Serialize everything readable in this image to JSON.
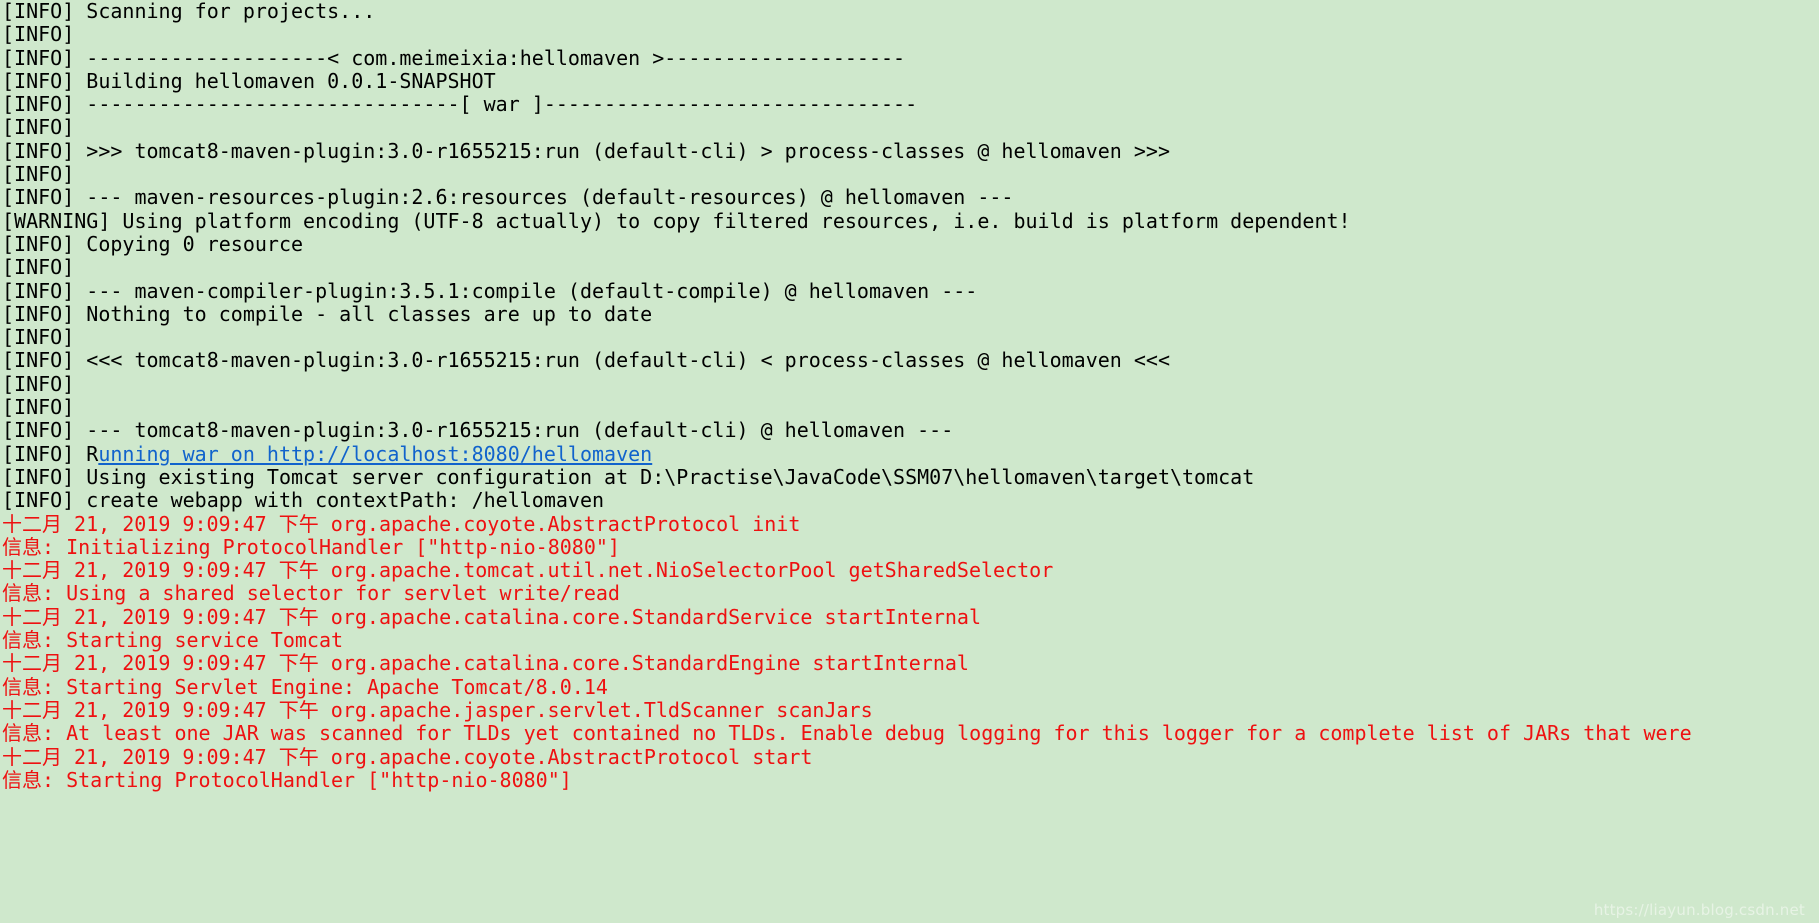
{
  "terminal": {
    "background_color": "#cfe8cc",
    "default_text_color": "#000000",
    "tomcat_log_color": "#ee1111",
    "link_color": "#1163cc",
    "watermark": "https://liayun.blog.csdn.net",
    "lines": [
      {
        "kind": "info",
        "text": "[INFO] Scanning for projects..."
      },
      {
        "kind": "info",
        "text": "[INFO] "
      },
      {
        "kind": "info",
        "text": "[INFO] --------------------< com.meimeixia:hellomaven >--------------------"
      },
      {
        "kind": "info",
        "text": "[INFO] Building hellomaven 0.0.1-SNAPSHOT"
      },
      {
        "kind": "info",
        "text": "[INFO] -------------------------------[ war ]-------------------------------"
      },
      {
        "kind": "info",
        "text": "[INFO] "
      },
      {
        "kind": "info",
        "text": "[INFO] >>> tomcat8-maven-plugin:3.0-r1655215:run (default-cli) > process-classes @ hellomaven >>>"
      },
      {
        "kind": "info",
        "text": "[INFO] "
      },
      {
        "kind": "info",
        "text": "[INFO] --- maven-resources-plugin:2.6:resources (default-resources) @ hellomaven ---"
      },
      {
        "kind": "warn",
        "text": "[WARNING] Using platform encoding (UTF-8 actually) to copy filtered resources, i.e. build is platform dependent!"
      },
      {
        "kind": "info",
        "text": "[INFO] Copying 0 resource"
      },
      {
        "kind": "info",
        "text": "[INFO] "
      },
      {
        "kind": "info",
        "text": "[INFO] --- maven-compiler-plugin:3.5.1:compile (default-compile) @ hellomaven ---"
      },
      {
        "kind": "info",
        "text": "[INFO] Nothing to compile - all classes are up to date"
      },
      {
        "kind": "info",
        "text": "[INFO] "
      },
      {
        "kind": "info",
        "text": "[INFO] <<< tomcat8-maven-plugin:3.0-r1655215:run (default-cli) < process-classes @ hellomaven <<<"
      },
      {
        "kind": "info",
        "text": "[INFO] "
      },
      {
        "kind": "info",
        "text": "[INFO] "
      },
      {
        "kind": "info",
        "text": "[INFO] --- tomcat8-maven-plugin:3.0-r1655215:run (default-cli) @ hellomaven ---"
      },
      {
        "kind": "info",
        "segments": [
          {
            "style": "plain",
            "text": "[INFO] R"
          },
          {
            "style": "link",
            "text": "unning war on http://localhost:8080/hellomaven"
          }
        ]
      },
      {
        "kind": "info",
        "text": "[INFO] Using existing Tomcat server configuration at D:\\Practise\\JavaCode\\SSM07\\hellomaven\\target\\tomcat"
      },
      {
        "kind": "info",
        "text": "[INFO] create webapp with contextPath: /hellomaven"
      },
      {
        "kind": "tomcat",
        "text": "十二月 21, 2019 9:09:47 下午 org.apache.coyote.AbstractProtocol init"
      },
      {
        "kind": "tomcat",
        "text": "信息: Initializing ProtocolHandler [\"http-nio-8080\"]"
      },
      {
        "kind": "tomcat",
        "text": "十二月 21, 2019 9:09:47 下午 org.apache.tomcat.util.net.NioSelectorPool getSharedSelector"
      },
      {
        "kind": "tomcat",
        "text": "信息: Using a shared selector for servlet write/read"
      },
      {
        "kind": "tomcat",
        "text": "十二月 21, 2019 9:09:47 下午 org.apache.catalina.core.StandardService startInternal"
      },
      {
        "kind": "tomcat",
        "text": "信息: Starting service Tomcat"
      },
      {
        "kind": "tomcat",
        "text": "十二月 21, 2019 9:09:47 下午 org.apache.catalina.core.StandardEngine startInternal"
      },
      {
        "kind": "tomcat",
        "text": "信息: Starting Servlet Engine: Apache Tomcat/8.0.14"
      },
      {
        "kind": "tomcat",
        "text": "十二月 21, 2019 9:09:47 下午 org.apache.jasper.servlet.TldScanner scanJars"
      },
      {
        "kind": "tomcat",
        "text": "信息: At least one JAR was scanned for TLDs yet contained no TLDs. Enable debug logging for this logger for a complete list of JARs that were"
      },
      {
        "kind": "tomcat",
        "text": "十二月 21, 2019 9:09:47 下午 org.apache.coyote.AbstractProtocol start"
      },
      {
        "kind": "tomcat",
        "text": "信息: Starting ProtocolHandler [\"http-nio-8080\"]"
      }
    ]
  }
}
